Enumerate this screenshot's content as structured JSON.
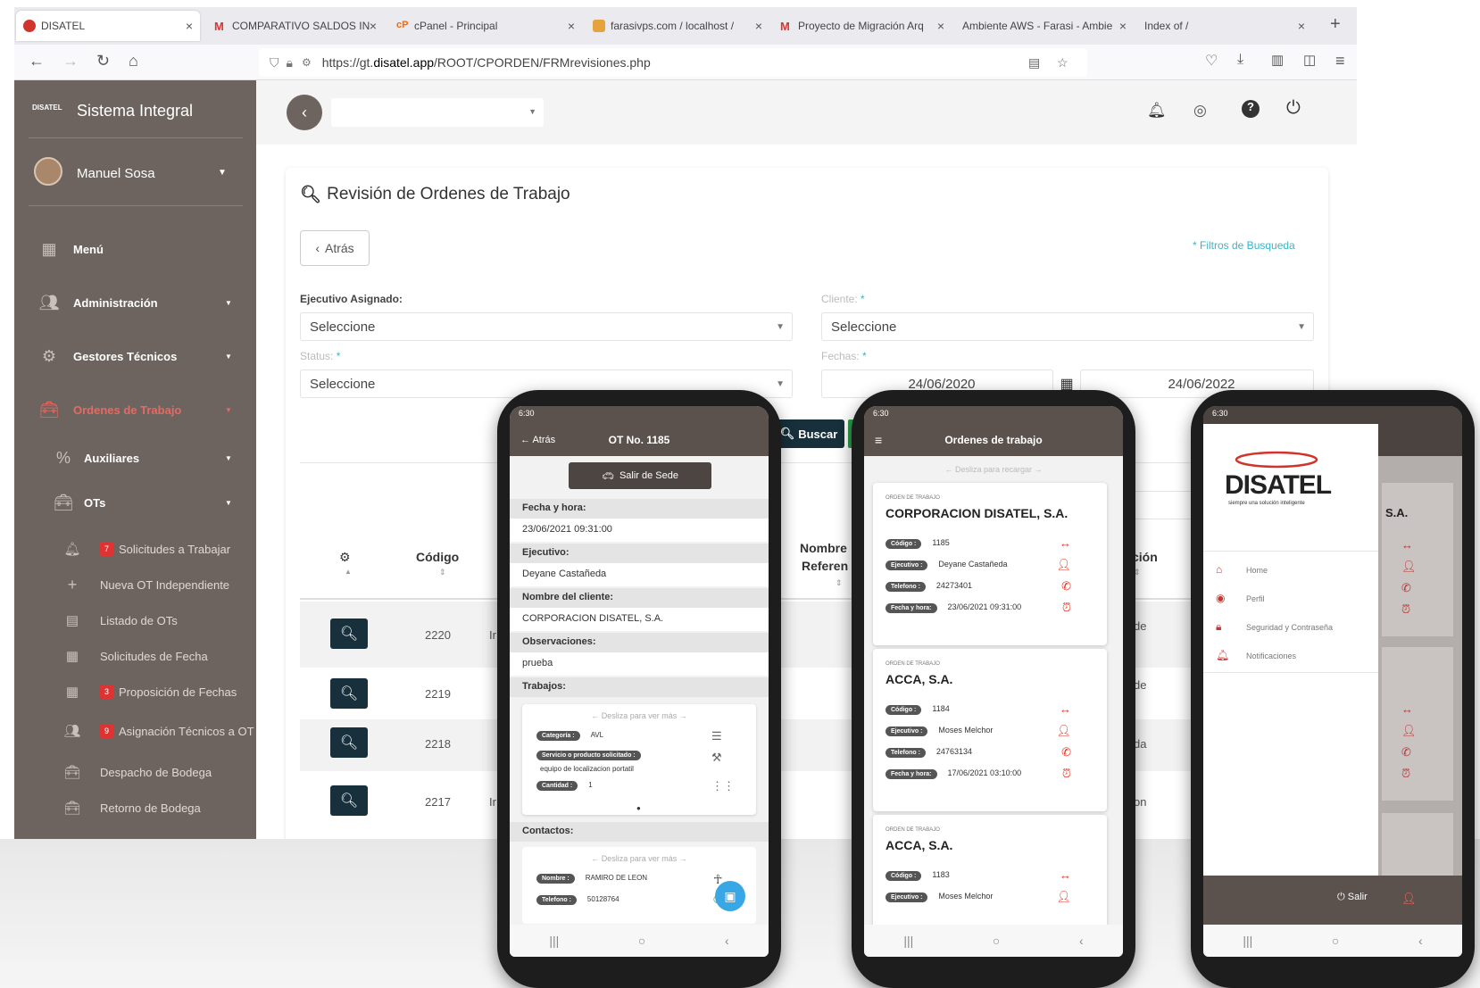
{
  "browser": {
    "tabs": [
      {
        "label": "DISATEL",
        "active": true
      },
      {
        "label": "COMPARATIVO SALDOS IN",
        "active": false
      },
      {
        "label": "cPanel - Principal",
        "active": false
      },
      {
        "label": "farasivps.com / localhost / ",
        "active": false
      },
      {
        "label": "Proyecto de Migración Arq",
        "active": false
      },
      {
        "label": "Ambiente AWS - Farasi - Ambie",
        "active": false
      },
      {
        "label": "Index of /",
        "active": false
      }
    ],
    "url_prefix": "https://gt.",
    "url_domain": "disatel.app",
    "url_path": "/ROOT/CPORDEN/FRMrevisiones.php"
  },
  "sidebar": {
    "brand_logo": "DISATEL",
    "app_name": "Sistema Integral",
    "user_name": "Manuel Sosa",
    "items": [
      {
        "label": "Menú",
        "icon": "grid-icon"
      },
      {
        "label": "Administración",
        "icon": "users-cog-icon"
      },
      {
        "label": "Gestores Técnicos",
        "icon": "cogs-icon"
      },
      {
        "label": "Ordenes de Trabajo",
        "icon": "toolbox-icon"
      },
      {
        "label": "Auxiliares",
        "icon": "percent-icon"
      },
      {
        "label": "OTs",
        "icon": "toolbox-icon"
      }
    ],
    "subitems": [
      {
        "label": "Solicitudes a Trabajar",
        "badge": "7",
        "icon": "bell-icon"
      },
      {
        "label": "Nueva OT Independiente",
        "badge": "",
        "icon": "plus-icon"
      },
      {
        "label": "Listado de OTs",
        "badge": "",
        "icon": "list-icon"
      },
      {
        "label": "Solicitudes de Fecha",
        "badge": "",
        "icon": "calendar-icon"
      },
      {
        "label": "Proposición de Fechas",
        "badge": "3",
        "icon": "calendar-check-icon"
      },
      {
        "label": "Asignación Técnicos a OT",
        "badge": "9",
        "icon": "users-icon"
      },
      {
        "label": "Despacho de Bodega",
        "badge": "",
        "icon": "toolbox-icon"
      },
      {
        "label": "Retorno de Bodega",
        "badge": "",
        "icon": "toolbox-icon"
      }
    ]
  },
  "main": {
    "title": "Revisión de Ordenes de Trabajo",
    "back_label": "Atrás",
    "filters_link": "* Filtros de Busqueda",
    "ejecutivo_label": "Ejecutivo Asignado:",
    "ejecutivo_value": "Seleccione",
    "cliente_label": "Cliente:",
    "cliente_value": "Seleccione",
    "status_label": "Status:",
    "status_value": "Seleccione",
    "fechas_label": "Fechas:",
    "fecha_desde": "24/06/2020",
    "fecha_hasta": "24/06/2022",
    "buscar_label": "Buscar",
    "columns": {
      "codigo": "Código",
      "nombre": "Nombre",
      "referencia": "Referen",
      "cion": "ción"
    },
    "rows": [
      {
        "codigo": "2220",
        "pre": "Ir",
        "post": "de"
      },
      {
        "codigo": "2219",
        "pre": "",
        "post": "de"
      },
      {
        "codigo": "2218",
        "pre": "",
        "post": "da"
      },
      {
        "codigo": "2217",
        "pre": "Ir",
        "post": "on"
      }
    ]
  },
  "phone1": {
    "time": "6:30",
    "back": "Atrás",
    "title": "OT No. 1185",
    "exit_button": "Salir de Sede",
    "fields": [
      {
        "label": "Fecha y hora:",
        "value": "23/06/2021 09:31:00"
      },
      {
        "label": "Ejecutivo:",
        "value": "Deyane Castañeda"
      },
      {
        "label": "Nombre del cliente:",
        "value": "CORPORACION DISATEL, S.A."
      },
      {
        "label": "Observaciones:",
        "value": "prueba"
      }
    ],
    "trabajos_label": "Trabajos:",
    "swipe_hint": "Desliza para ver más",
    "categoria_pill": "Categoría :",
    "categoria_value": "AVL",
    "servicio_pill": "Servicio o producto solicitado :",
    "servicio_value": "equipo de localizacion portatil",
    "cantidad_pill": "Cantidad :",
    "cantidad_value": "1",
    "contactos_label": "Contactos:",
    "nombre_pill": "Nombre :",
    "nombre_value": "RAMIRO DE LEON",
    "telefono_pill": "Telefono :",
    "telefono_value": "50128764"
  },
  "phone2": {
    "time": "6:30",
    "title": "Ordenes de trabajo",
    "refresh_hint": "Desliza para recargar",
    "overline": "ORDEN DE TRABAJO",
    "pills": {
      "codigo": "Código :",
      "ejecutivo": "Ejecutivo :",
      "telefono": "Telefono :",
      "fecha": "Fecha y hora:"
    },
    "orders": [
      {
        "client": "CORPORACION DISATEL, S.A.",
        "codigo": "1185",
        "ejecutivo": "Deyane Castañeda",
        "telefono": "24273401",
        "fecha": "23/06/2021 09:31:00"
      },
      {
        "client": "ACCA, S.A.",
        "codigo": "1184",
        "ejecutivo": "Moses Melchor",
        "telefono": "24763134",
        "fecha": "17/06/2021 03:10:00"
      },
      {
        "client": "ACCA, S.A.",
        "codigo": "1183",
        "ejecutivo": "Moses Melchor",
        "telefono": "",
        "fecha": ""
      }
    ]
  },
  "phone3": {
    "time": "6:30",
    "logo": "DISATEL",
    "tagline": "siempre una solución inteligente",
    "menu": [
      {
        "label": "Home",
        "icon": "home-icon"
      },
      {
        "label": "Perfil",
        "icon": "user-circle-icon"
      },
      {
        "label": "Seguridad y Contraseña",
        "icon": "lock-icon"
      },
      {
        "label": "Notificaciones",
        "icon": "bell-icon"
      }
    ],
    "logout": "Salir",
    "peek_text": "S.A."
  },
  "colors": {
    "brand_red": "#d0342c",
    "sidebar": "#6d6460",
    "dark_button": "#17303b",
    "accent_teal": "#39b4c7"
  }
}
